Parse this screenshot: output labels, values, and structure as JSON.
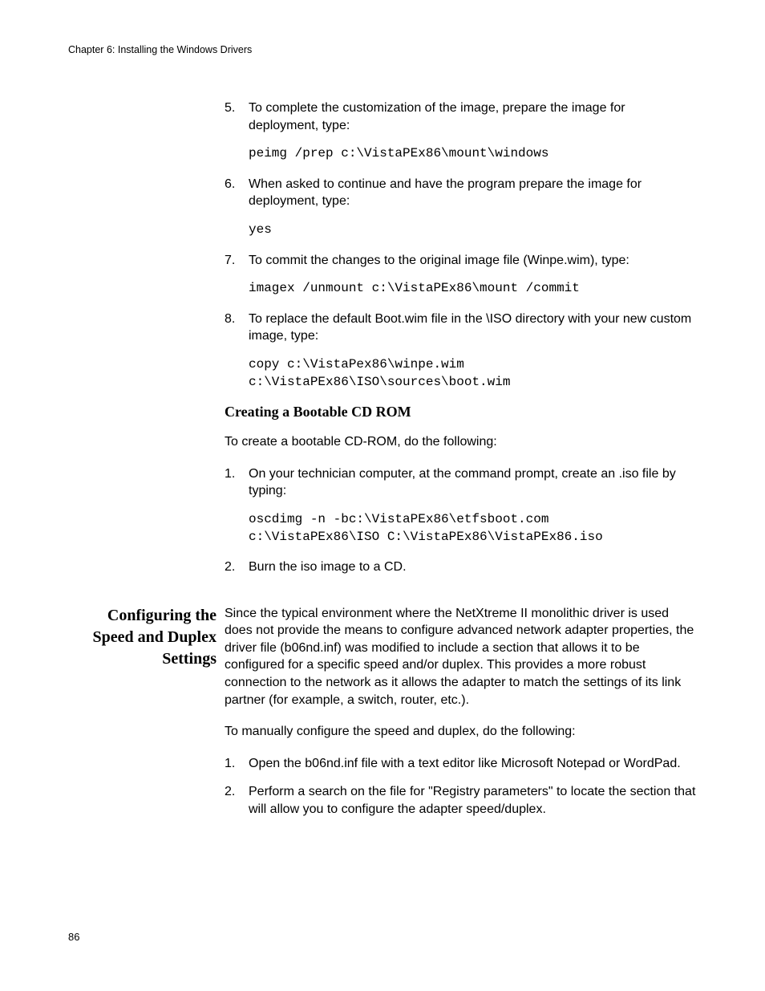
{
  "header": {
    "running": "Chapter 6: Installing the Windows Drivers"
  },
  "steps_a": {
    "s5": {
      "num": "5.",
      "text": "To complete the customization of the image, prepare the image for deployment, type:"
    },
    "code5": "peimg /prep c:\\VistaPEx86\\mount\\windows",
    "s6": {
      "num": "6.",
      "text": "When asked to continue and have the program prepare the image for deployment, type:"
    },
    "code6": "yes",
    "s7": {
      "num": "7.",
      "text": "To commit the changes to the original image file (Winpe.wim), type:"
    },
    "code7": "imagex /unmount c:\\VistaPEx86\\mount /commit",
    "s8": {
      "num": "8.",
      "text": "To replace the default Boot.wim file in the \\ISO directory with your new custom image, type:"
    },
    "code8": "copy c:\\VistaPex86\\winpe.wim\nc:\\VistaPEx86\\ISO\\sources\\boot.wim"
  },
  "section_b": {
    "heading": "Creating a Bootable CD ROM",
    "intro": "To create a bootable CD-ROM, do the following:",
    "s1": {
      "num": "1.",
      "text": "On your technician computer, at the command prompt, create an .iso file by typing:"
    },
    "code1": "oscdimg -n -bc:\\VistaPEx86\\etfsboot.com\nc:\\VistaPEx86\\ISO C:\\VistaPEx86\\VistaPEx86.iso",
    "s2": {
      "num": "2.",
      "text": "Burn the iso image to a CD."
    }
  },
  "section_c": {
    "sidebar": "Configuring the Speed and Duplex Settings",
    "para1": "Since the typical environment where the NetXtreme II monolithic driver is used does not provide the means to configure advanced network adapter properties, the driver file (b06nd.inf) was modified to include a section that allows it to be configured for a specific speed and/or duplex. This provides a more robust connection to the network as it allows the adapter to match the settings of its link partner (for example, a switch, router, etc.).",
    "para2": "To manually configure the speed and duplex, do the following:",
    "s1": {
      "num": "1.",
      "text": "Open the b06nd.inf file with a text editor like Microsoft Notepad or WordPad."
    },
    "s2": {
      "num": "2.",
      "text": "Perform a search on the file for \"Registry parameters\" to locate the section that will allow you to configure the adapter speed/duplex."
    }
  },
  "footer": {
    "page": "86"
  }
}
